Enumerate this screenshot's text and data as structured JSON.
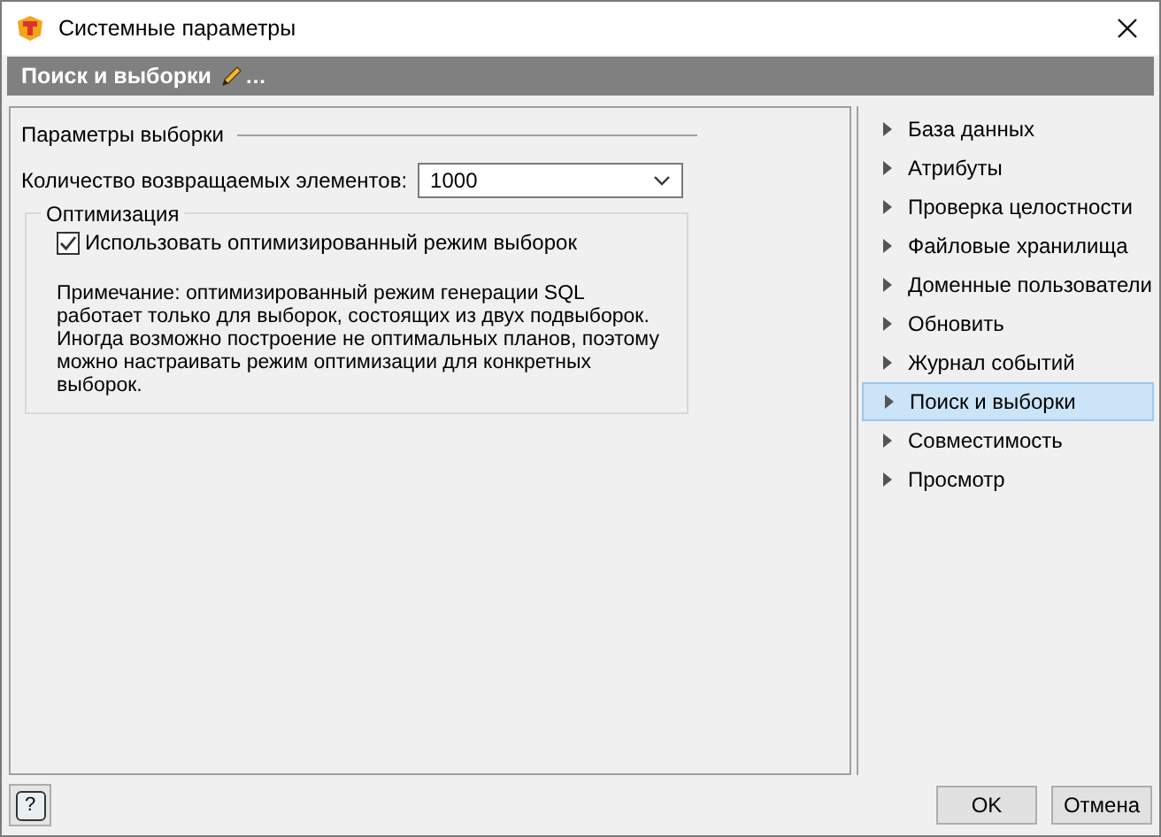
{
  "window": {
    "title": "Системные параметры"
  },
  "header": {
    "title": "Поиск и выборки",
    "suffix": "…"
  },
  "section": {
    "title": "Параметры выборки",
    "count_label": "Количество возвращаемых элементов:",
    "count_value": "1000"
  },
  "optimization": {
    "title": "Оптимизация",
    "checkbox": {
      "label": "Использовать оптимизированный режим выборок",
      "checked": true
    },
    "note": "Примечание: оптимизированный режим генерации SQL работает только для выборок, состоящих из двух подвыборок. Иногда возможно построение не оптимальных планов, поэтому можно настраивать режим оптимизации для конкретных выборок."
  },
  "sidebar": {
    "items": [
      {
        "label": "База данных",
        "selected": false
      },
      {
        "label": "Атрибуты",
        "selected": false
      },
      {
        "label": "Проверка целостности",
        "selected": false
      },
      {
        "label": "Файловые хранилища",
        "selected": false
      },
      {
        "label": "Доменные пользователи",
        "selected": false
      },
      {
        "label": "Обновить",
        "selected": false
      },
      {
        "label": "Журнал событий",
        "selected": false
      },
      {
        "label": "Поиск и выборки",
        "selected": true
      },
      {
        "label": "Совместимость",
        "selected": false
      },
      {
        "label": "Просмотр",
        "selected": false
      }
    ]
  },
  "help_button": {
    "label": "?"
  },
  "buttons": [
    "OK",
    "Отмена"
  ]
}
